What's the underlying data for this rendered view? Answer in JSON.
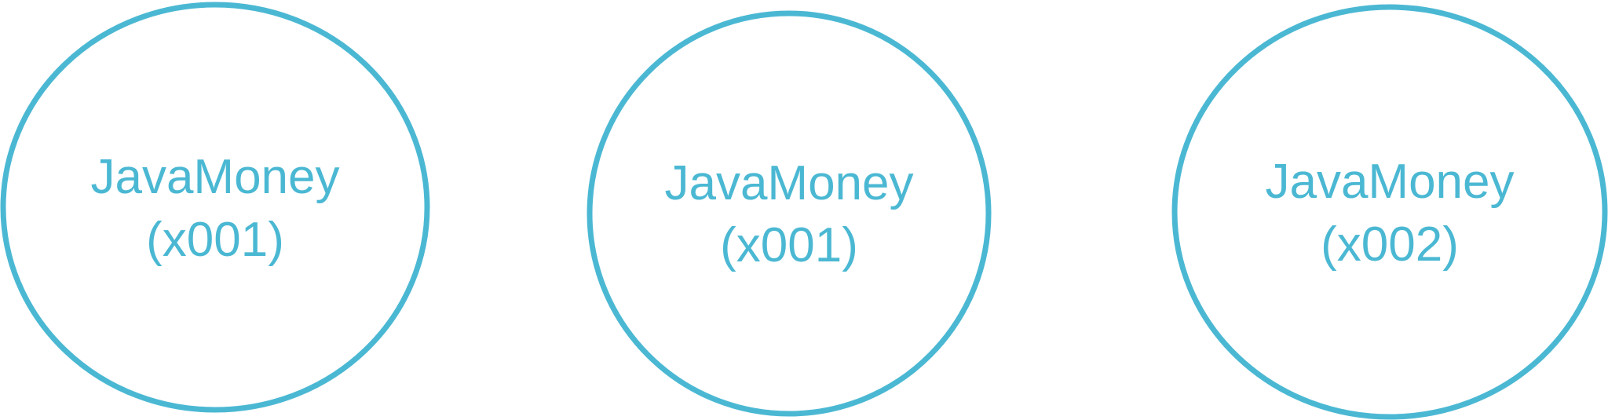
{
  "colors": {
    "stroke": "#4BB8D3",
    "text": "#4BB8D3",
    "background": "#FFFFFF"
  },
  "nodes": [
    {
      "line1": "JavaMoney",
      "line2": "(x001)"
    },
    {
      "line1": "JavaMoney",
      "line2": "(x001)"
    },
    {
      "line1": "JavaMoney",
      "line2": "(x002)"
    }
  ]
}
